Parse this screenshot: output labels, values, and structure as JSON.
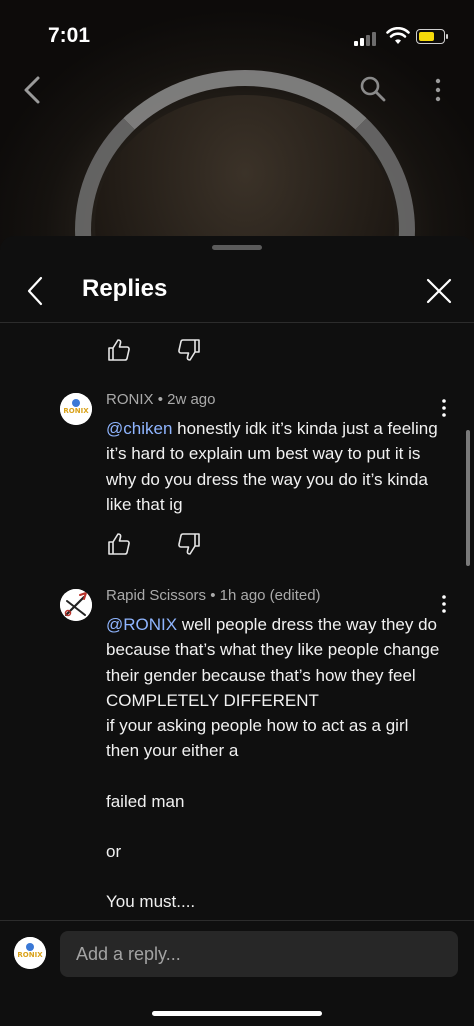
{
  "status_bar": {
    "time": "7:01"
  },
  "sheet": {
    "title": "Replies"
  },
  "comments": [
    {
      "author": "RONIX",
      "age": "2w ago",
      "mention": "@chiken",
      "text": "honestly idk it’s kinda just a feeling it’s hard to explain um best way to put it is why do you dress the way you do it’s kinda like that ig",
      "avatar_text": "RONIX"
    },
    {
      "author": "Rapid Scissors",
      "age": "1h ago (edited)",
      "mention": "@RONIX",
      "lines": [
        "well people dress the way they do because that’s what they like people change their gender because that’s how they feel COMPLETELY DIFFERENT",
        "if your asking people how to act as a girl then your either a",
        "failed man",
        "or",
        "You must...."
      ]
    }
  ],
  "composer": {
    "placeholder": "Add a reply...",
    "avatar_text": "RONIX"
  },
  "colors": {
    "mention": "#8fb5ff",
    "background": "#0f0f0f",
    "input": "#272727"
  }
}
